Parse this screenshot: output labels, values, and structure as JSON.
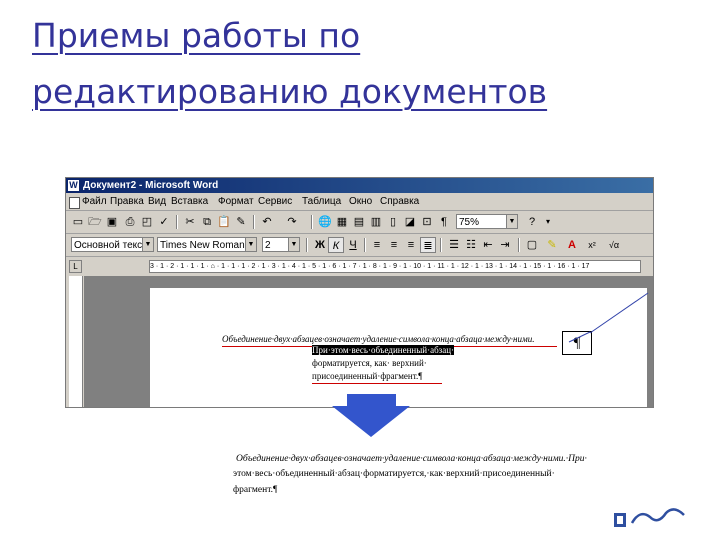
{
  "slide": {
    "title_line1": "Приемы работы по",
    "title_line2": "редактированию документов"
  },
  "window": {
    "title": "Документ2 - Microsoft Word",
    "menu": [
      "Файл",
      "Правка",
      "Вид",
      "Вставка",
      "Формат",
      "Сервис",
      "Таблица",
      "Окно",
      "Справка"
    ]
  },
  "toolbar": {
    "zoom": "75%",
    "help": "?",
    "style": "Основной текст",
    "font": "Times New Roman",
    "size": "2",
    "bold": "Ж",
    "italic": "К",
    "underline": "Ч"
  },
  "ruler": {
    "ticks": "3 · 1 · 2 · 1 · 1 · 1 · ⌂ · 1 · 1 · 1 · 2 · 1 · 3 · 1 · 4 · 1 · 5 · 1 · 6 · 1 · 7 · 1 · 8 · 1 · 9 · 1 · 10 · 1 · 11 · 1 · 12 · 1 · 13 · 1 · 14 · 1 · 15 · 1 · 16 · 1 · 17"
  },
  "document": {
    "line1": "Объединение·двух·абзацев·означает·удаление·символа·конца·абзаца·между·ними.",
    "line2": "При·этом·весь·объединенный·абзац·",
    "line3": "форматируется,      как·      верхний·",
    "line4": "присоединенный·фрагмент.¶"
  },
  "annotation": {
    "pilcrow": "¶"
  },
  "result": {
    "line1": "Объединение·двух·абзацев·означает·удаление·символа·конца·абзаца·между·ними.·При·",
    "line2": "этом·весь·объединенный·абзац·форматируется,·как·верхний·присоединенный·",
    "line3": "фрагмент.¶"
  },
  "colors": {
    "title": "#333399",
    "arrow": "#3355cc",
    "annotation_line": "#3344aa"
  }
}
